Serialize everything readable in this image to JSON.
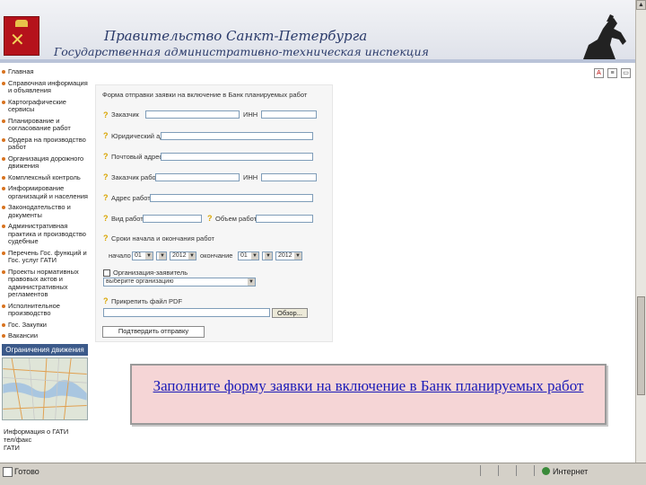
{
  "header": {
    "title_line1": "Правительство Санкт-Петербурга",
    "title_line2": "Государственная административно-техническая инспекция"
  },
  "toolbar_icons": [
    "pdf-icon",
    "document-icon",
    "printer-icon"
  ],
  "nav": {
    "items": [
      "Главная",
      "Справочная информация и объявления",
      "Картографические сервисы",
      "Планирование и согласование работ",
      "Ордера на производство работ",
      "Организация дорожного движения",
      "Комплексный контроль",
      "Информирование организаций и населения",
      "Законодательство и документы",
      "Административная практика и производство судебные",
      "Перечень Гос. функций и Гос. услуг ГАТИ",
      "Проекты нормативных правовых актов и административных регламентов",
      "Исполнительное производство",
      "Гос. Закупки",
      "Вакансии"
    ],
    "traffic_title": "Ограничения движения",
    "map_note": [
      "Информация о ГАТИ",
      "тел/факс",
      "ГАТИ"
    ]
  },
  "form": {
    "heading": "Форма отправки заявки на включение в Банк планируемых работ",
    "customer_label": "Заказчик",
    "inn_label": "ИНН",
    "legal_address_label": "Юридический адрес",
    "postal_address_label": "Почтовый адрес",
    "contractor_label": "Заказчик работ",
    "inn2_label": "ИНН",
    "work_address_label": "Адрес работ",
    "work_type_label": "Вид работ",
    "work_volume_label": "Объем работ",
    "dates_label": "Сроки начала и окончания работ",
    "start_label": "начало",
    "start_day": "01",
    "start_year": "2012",
    "end_label": "окончание",
    "end_day": "01",
    "end_year": "2012",
    "org_label": "Организация-заявитель",
    "org_value": "выберите организацию",
    "file_label": "Прикрепить файл PDF",
    "browse_label": "Обзор...",
    "submit_label": "Подтвердить отправку"
  },
  "callout": {
    "text": "Заполните форму заявки на включение в Банк планируемых работ"
  },
  "statusbar": {
    "left_text": "Готово",
    "right_text": "Интернет"
  }
}
